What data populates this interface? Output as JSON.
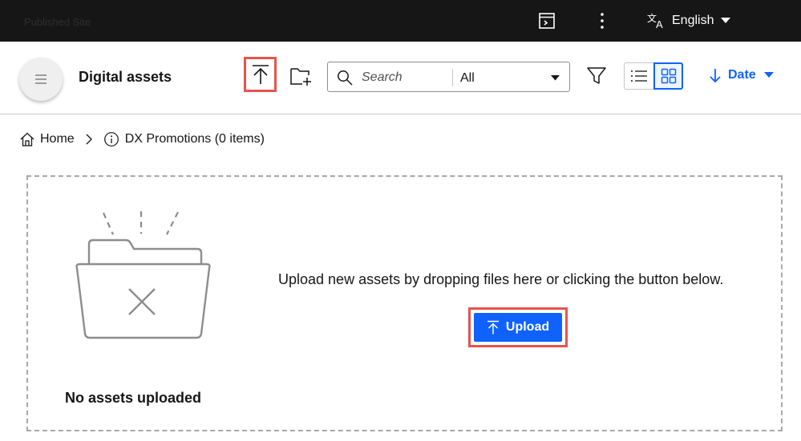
{
  "topbar": {
    "site_hint": "Published Site",
    "language": "English",
    "icons": {
      "preview": "preview-panel-icon",
      "more": "kebab-menu-icon",
      "translate": "translate-icon",
      "caret": "caret-down-icon"
    }
  },
  "header": {
    "title": "Digital assets",
    "search": {
      "placeholder": "Search",
      "value": "",
      "scope": "All"
    },
    "sort": {
      "label": "Date"
    },
    "icons": {
      "menu": "hamburger-icon",
      "upload": "upload-icon",
      "new_folder": "new-folder-icon",
      "filter": "filter-icon",
      "list_view": "list-view-icon",
      "grid_view": "grid-view-icon"
    }
  },
  "breadcrumb": {
    "home": "Home",
    "current": "DX Promotions (0 items)"
  },
  "empty_state": {
    "title": "No assets uploaded",
    "message": "Upload new assets by dropping files here or clicking the button below.",
    "upload_button": "Upload"
  },
  "colors": {
    "topbar_bg": "#161616",
    "accent": "#0f62fe",
    "highlight_border": "#e5544d",
    "dashed_border": "#a8a8a8"
  }
}
